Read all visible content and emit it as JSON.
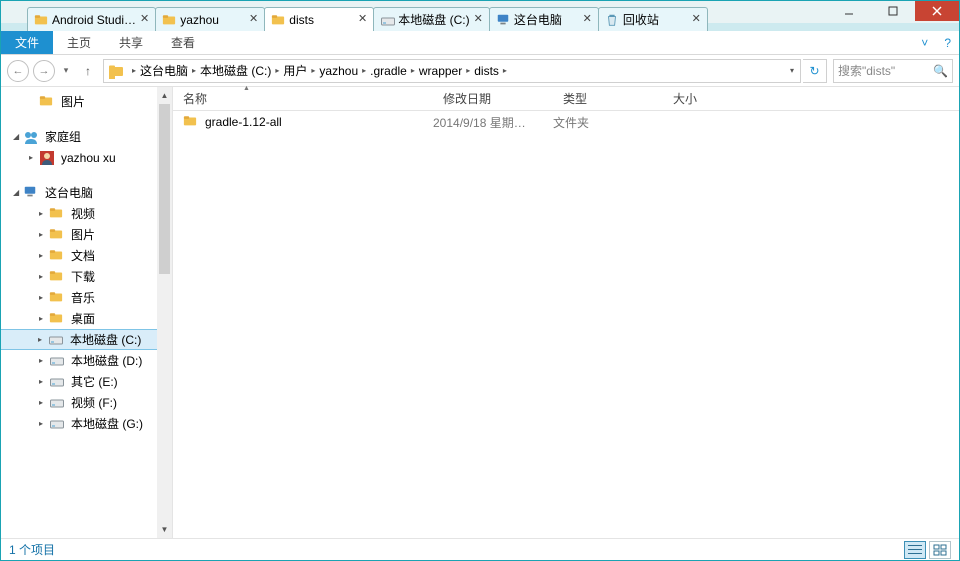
{
  "tabs": [
    {
      "label": "Android Studi…",
      "icon": "folder"
    },
    {
      "label": "yazhou",
      "icon": "folder"
    },
    {
      "label": "dists",
      "icon": "folder"
    },
    {
      "label": "本地磁盘 (C:)",
      "icon": "drive"
    },
    {
      "label": "这台电脑",
      "icon": "pc"
    },
    {
      "label": "回收站",
      "icon": "recycle"
    }
  ],
  "active_tab_index": 2,
  "ribbon": {
    "file": "文件",
    "menus": [
      "主页",
      "共享",
      "查看"
    ]
  },
  "breadcrumb": [
    "这台电脑",
    "本地磁盘 (C:)",
    "用户",
    "yazhou",
    ".gradle",
    "wrapper",
    "dists"
  ],
  "search_placeholder": "搜索\"dists\"",
  "columns": {
    "name": "名称",
    "date": "修改日期",
    "type": "类型",
    "size": "大小"
  },
  "rows": [
    {
      "name": "gradle-1.12-all",
      "date": "2014/9/18 星期…",
      "type": "文件夹",
      "size": ""
    }
  ],
  "sidebar": {
    "quick": [
      {
        "label": "图片",
        "icon": "folder"
      }
    ],
    "homegroup": {
      "label": "家庭组",
      "items": [
        {
          "label": "yazhou xu",
          "icon": "user"
        }
      ]
    },
    "pc": {
      "label": "这台电脑",
      "items": [
        {
          "label": "视频",
          "icon": "folder-media"
        },
        {
          "label": "图片",
          "icon": "folder-media"
        },
        {
          "label": "文档",
          "icon": "folder-doc"
        },
        {
          "label": "下载",
          "icon": "folder-down"
        },
        {
          "label": "音乐",
          "icon": "folder-music"
        },
        {
          "label": "桌面",
          "icon": "folder-desktop"
        },
        {
          "label": "本地磁盘 (C:)",
          "icon": "drive",
          "selected": true
        },
        {
          "label": "本地磁盘 (D:)",
          "icon": "drive"
        },
        {
          "label": "其它 (E:)",
          "icon": "drive"
        },
        {
          "label": "视频 (F:)",
          "icon": "drive"
        },
        {
          "label": "本地磁盘 (G:)",
          "icon": "drive"
        }
      ]
    }
  },
  "status": {
    "text": "1 个项目"
  }
}
